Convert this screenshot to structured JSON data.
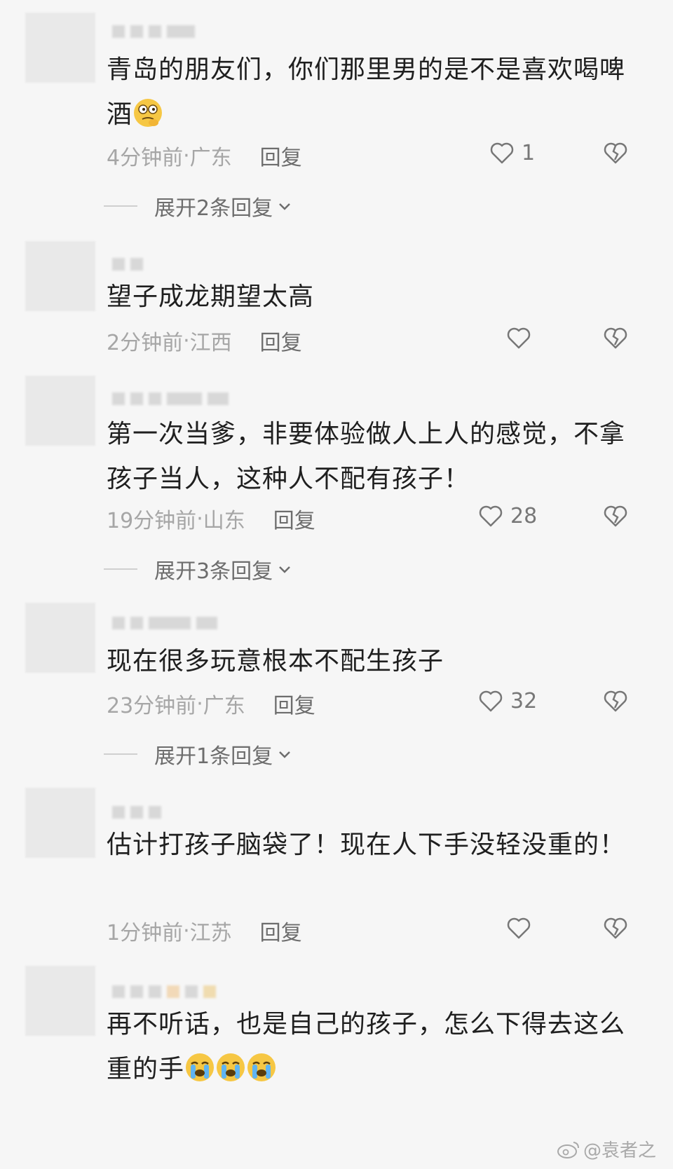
{
  "comments": [
    {
      "text": "青岛的朋友们，你们那里男的是不是喜欢喝啤酒",
      "time": "4分钟前",
      "location": "广东",
      "reply": "回复",
      "likes": "1",
      "expand": "展开2条回复"
    },
    {
      "text": "望子成龙期望太高",
      "time": "2分钟前",
      "location": "江西",
      "reply": "回复",
      "likes": ""
    },
    {
      "text": "第一次当爹，非要体验做人上人的感觉，不拿孩子当人，这种人不配有孩子！",
      "time": "19分钟前",
      "location": "山东",
      "reply": "回复",
      "likes": "28",
      "expand": "展开3条回复"
    },
    {
      "text": "现在很多玩意根本不配生孩子",
      "time": "23分钟前",
      "location": "广东",
      "reply": "回复",
      "likes": "32",
      "expand": "展开1条回复"
    },
    {
      "text": "估计打孩子脑袋了！现在人下手没轻没重的！",
      "time": "1分钟前",
      "location": "江苏",
      "reply": "回复",
      "likes": ""
    },
    {
      "text": "再不听话，也是自己的孩子，怎么下得去这么重的手"
    }
  ],
  "separator": " · ",
  "watermark": "@袁者之",
  "icons": {
    "like": "heart-outline-icon",
    "dislike": "broken-heart-icon",
    "expand": "chevron-down-icon",
    "emoji_thinking": "thinking-face-emoji",
    "emoji_crying": "loudly-crying-face-emoji",
    "watermark": "weibo-logo-icon"
  },
  "colors": {
    "background": "#f6f6f6",
    "text": "#1f1f1f",
    "meta": "#a6a6a6",
    "action": "#6d6d6d"
  }
}
